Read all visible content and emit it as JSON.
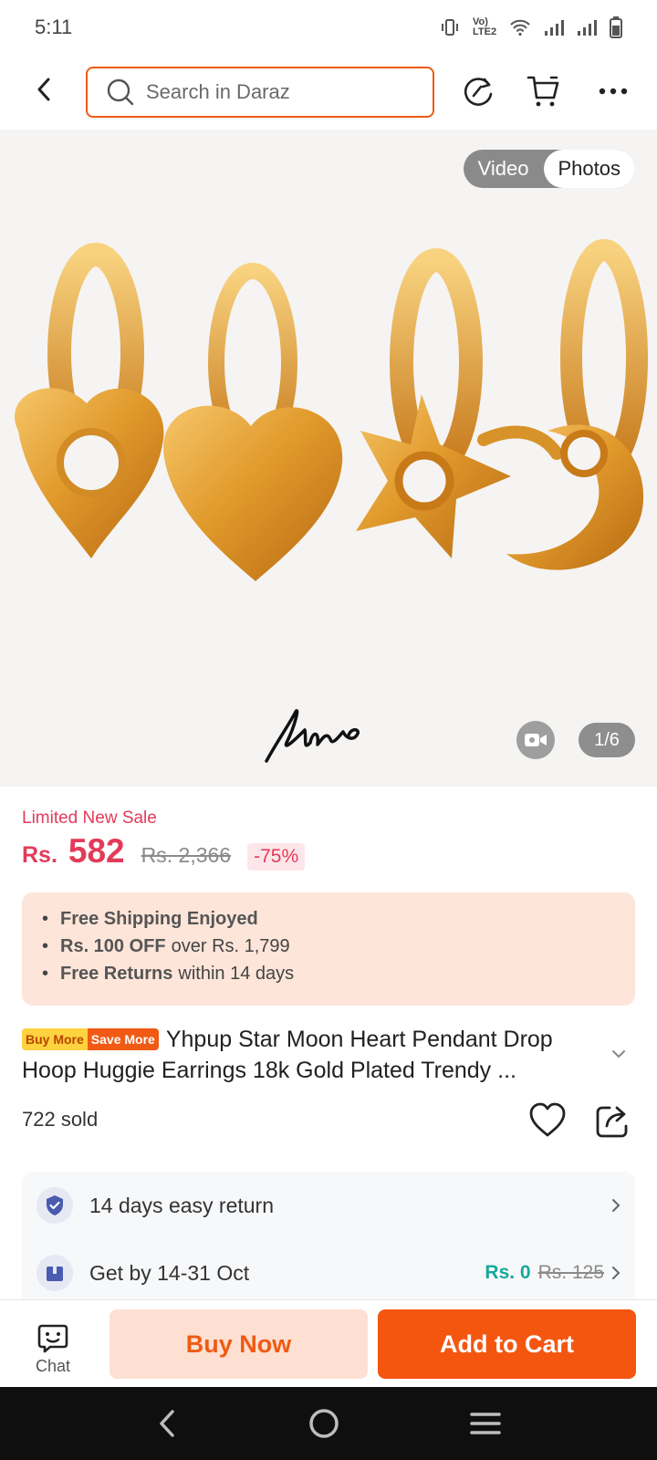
{
  "status_bar": {
    "time": "5:11",
    "network": "Vo) LTE2"
  },
  "search": {
    "placeholder": "Search in Daraz"
  },
  "gallery": {
    "tabs": [
      "Video",
      "Photos"
    ],
    "active_tab": "Photos",
    "counter": "1/6",
    "brand_logo_text": "Yhpup"
  },
  "price": {
    "sale_label": "Limited New Sale",
    "currency": "Rs.",
    "current": "582",
    "original": "Rs. 2,366",
    "discount": "-75%"
  },
  "benefits": [
    {
      "bold": "Free Shipping Enjoyed",
      "rest": ""
    },
    {
      "bold": "Rs. 100 OFF",
      "rest": "over Rs. 1,799"
    },
    {
      "bold": "Free Returns",
      "rest": "within 14 days"
    }
  ],
  "product": {
    "badge_left": "Buy More",
    "badge_right": "Save More",
    "title": "Yhpup Star Moon Heart Pendant Drop Hoop Huggie Earrings 18k Gold Plated Trendy ...",
    "sold": "722 sold"
  },
  "services": {
    "return": "14 days easy return",
    "delivery": "Get by 14-31 Oct",
    "shipping_fee": "Rs. 0",
    "shipping_fee_original": "Rs. 125"
  },
  "actions": {
    "chat": "Chat",
    "buy_now": "Buy Now",
    "add_to_cart": "Add to Cart"
  },
  "colors": {
    "brand_orange": "#f45610",
    "price_red": "#e33b5a",
    "teal": "#17a89b"
  }
}
